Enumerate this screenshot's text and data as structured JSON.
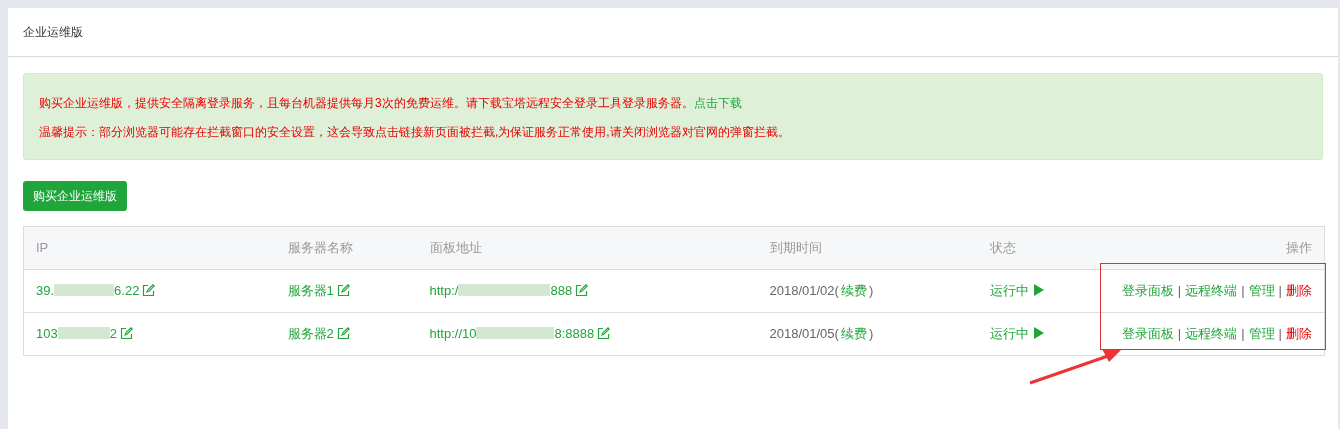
{
  "page_title": "企业运维版",
  "notice": {
    "line_1": "购买企业运维版，提供安全隔离登录服务，且每台机器提供每月3次的免费运维。请下载宝塔远程安全登录工具登录服务器。",
    "download_link": "点击下载",
    "line_2": "温馨提示：部分浏览器可能存在拦截窗口的安全设置，这会导致点击链接新页面被拦截,为保证服务正常使用,请关闭浏览器对官网的弹窗拦截。"
  },
  "buy_button": "购买企业运维版",
  "table": {
    "columns": [
      "IP",
      "服务器名称",
      "面板地址",
      "到期时间",
      "状态",
      "操作"
    ],
    "rows": [
      {
        "ip": {
          "prefix": "39.",
          "suffix": "6.22"
        },
        "name": "服务器1",
        "url": {
          "prefix": "http:/",
          "suffix": "888"
        },
        "expiry": "2018/01/02(",
        "renew": "续费",
        "close": ")",
        "status": "运行中",
        "running": true,
        "actions": [
          "登录面板",
          "远程终端",
          "管理",
          "删除"
        ],
        "separators": [
          "|",
          "|",
          "|"
        ]
      },
      {
        "ip": {
          "prefix": "103",
          "suffix": "2"
        },
        "name": "服务器2",
        "url": {
          "prefix": "http://10",
          "suffix": "8:8888"
        },
        "expiry": "2018/01/05(",
        "renew": "续费",
        "close": ")",
        "status": "运行中",
        "running": true,
        "actions": [
          "登录面板",
          "远程终端",
          "管理",
          "删除"
        ],
        "separators": [
          "|",
          "|",
          "|"
        ]
      }
    ]
  }
}
